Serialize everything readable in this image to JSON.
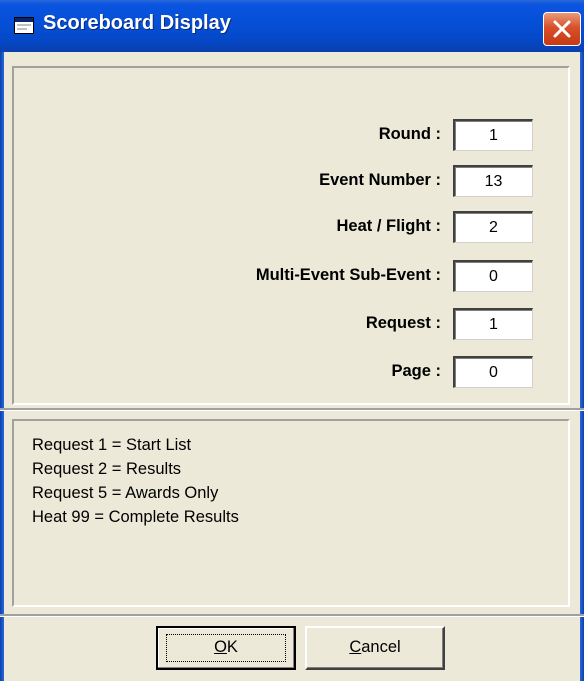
{
  "window": {
    "title": "Scoreboard Display",
    "titlebar_color": "#0a54e0",
    "close_button_color": "#d8502a"
  },
  "fields": [
    {
      "label": "Round :",
      "value": "1"
    },
    {
      "label": "Event Number :",
      "value": "13"
    },
    {
      "label": "Heat / Flight :",
      "value": "2"
    },
    {
      "label": "Multi-Event Sub-Event :",
      "value": "0"
    },
    {
      "label": "Request :",
      "value": "1"
    },
    {
      "label": "Page :",
      "value": "0"
    }
  ],
  "info": [
    "Request 1 = Start List",
    "Request 2 = Results",
    "Request 5 = Awards Only",
    "Heat 99 = Complete Results"
  ],
  "buttons": {
    "ok": {
      "mnemonic": "O",
      "rest": "K"
    },
    "cancel": {
      "mnemonic": "C",
      "rest": "ancel"
    }
  }
}
